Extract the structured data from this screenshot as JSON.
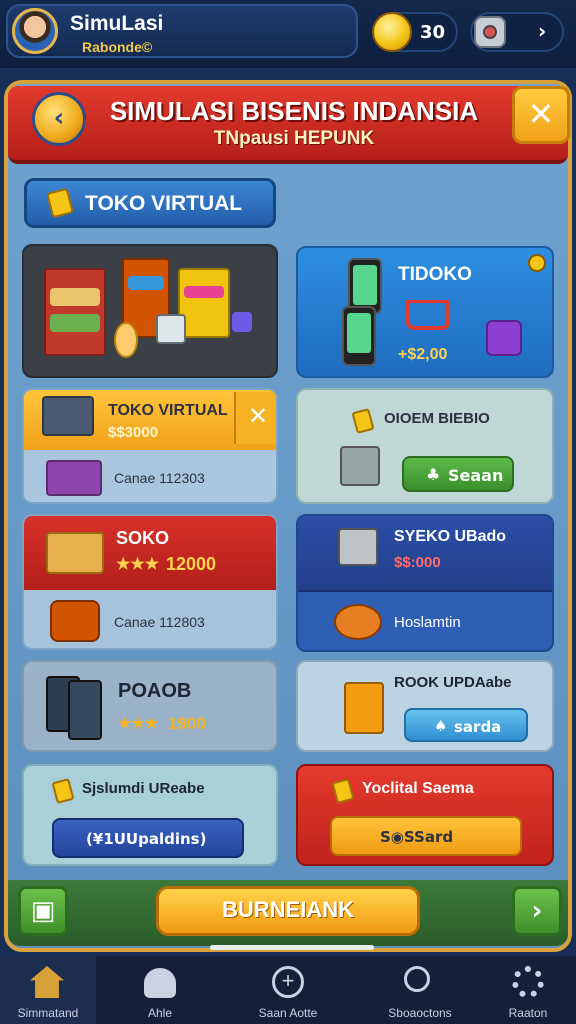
{
  "header": {
    "player_name": "SimuLasi",
    "player_sub": "Rabonde©",
    "coins": "30",
    "settings_chevron": "›"
  },
  "title": {
    "main": "SIMULASI BISENIS INDANSIA",
    "sub": "TNpausi HEPUNK"
  },
  "section_button": "TOKO VIRTUAL",
  "cards": {
    "tidoko": {
      "title": "TIDOKO",
      "price": "+$2,00"
    },
    "toko_virtual": {
      "title": "TOKO VIRTUAL",
      "price": "$$3000",
      "sub": "Canae 112303"
    },
    "ordem": {
      "title": "OIOEM BIEBIO",
      "button": "Seaan"
    },
    "soko": {
      "title": "SOKO",
      "stars": "★★★",
      "price": "12000",
      "sub": "Canae 112803"
    },
    "syoko": {
      "title": "SYEKO UBado",
      "price": "$$:000",
      "sub": "Hoslamtin"
    },
    "poaob": {
      "title": "POAOB",
      "stars": "★★★",
      "price": "1900"
    },
    "rook": {
      "title": "ROOK UPDAabe",
      "button": "sarda"
    },
    "sjslumd": {
      "title": "Sjslumdi UReabe",
      "button": "(¥1UUpaldins)"
    },
    "yoclital": {
      "title": "Yoclital Saema",
      "button": "S◉SSard"
    }
  },
  "bottom": {
    "main_button": "BURNEIANK"
  },
  "nav": [
    {
      "label": "Simmatand"
    },
    {
      "label": "Ahle"
    },
    {
      "label": "Saan Aotte"
    },
    {
      "label": "Sboaoctons"
    },
    {
      "label": "Raaton"
    }
  ]
}
